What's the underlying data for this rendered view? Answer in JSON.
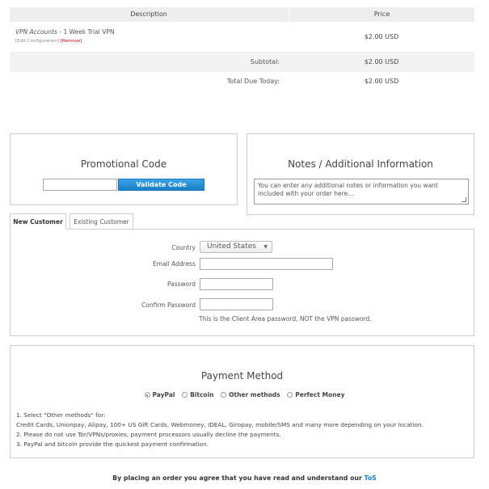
{
  "cart": {
    "headers": [
      "Description",
      "Price"
    ],
    "item": {
      "name": "VPN Accounts",
      "suffix": " - 1 Week Trial VPN",
      "edit_link": "[Edit Configuration]",
      "remove_link": "[Remove]",
      "price": "$2.00 USD"
    },
    "subtotal_label": "Subtotal:",
    "subtotal_value": "$2.00 USD",
    "total_label": "Total Due Today:",
    "total_value": "$2.00 USD"
  },
  "promo": {
    "title": "Promotional Code",
    "input_value": "",
    "button_label": "Validate Code"
  },
  "notes": {
    "title": "Notes / Additional Information",
    "placeholder": "You can enter any additional notes or information you want included with your order here..."
  },
  "tabs": {
    "new_customer": "New Customer",
    "existing_customer": "Existing Customer"
  },
  "form": {
    "country_label": "Country",
    "country_value": "United States",
    "email_label": "Email Address",
    "password_label": "Password",
    "confirm_label": "Confirm Password",
    "password_hint": "This is the Client Area password, NOT the VPN password."
  },
  "payment": {
    "title": "Payment Method",
    "methods": [
      "PayPal",
      "Bitcoin",
      "Other methods",
      "Perfect Money"
    ],
    "selected": "PayPal",
    "notes": [
      "1. Select \"Other methods\" for:",
      "Credit Cards, Unionpay, Alipay, 100+ US Gift Cards, Webmoney, IDEAL, Giropay, mobile/SMS and many more depending on your location.",
      "2. Please do not use Tor/VPNs/proxies; payment processors usually decline the payments.",
      "3. PayPal and bitcoin provide the quickest payment confirmation."
    ]
  },
  "footer": {
    "agreement": "By placing an order you agree that you have read and understand our ",
    "tos_link": "ToS"
  }
}
